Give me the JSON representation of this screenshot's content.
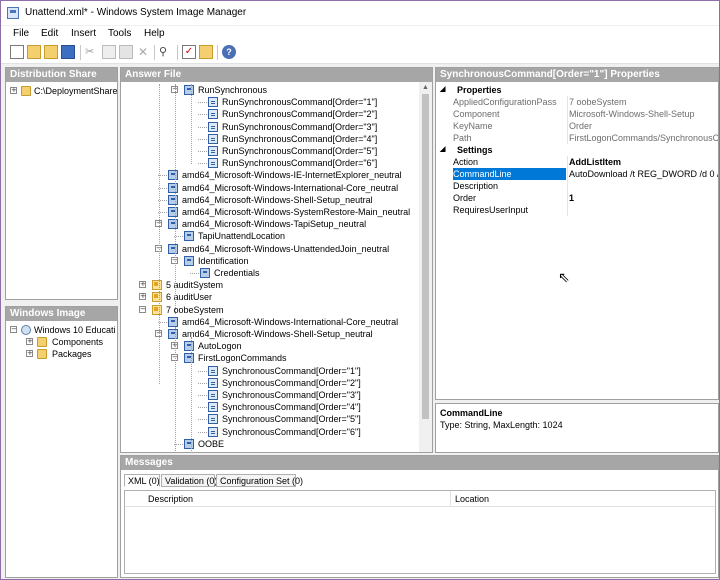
{
  "window": {
    "title": "Unattend.xml* - Windows System Image Manager"
  },
  "menu": [
    "File",
    "Edit",
    "Insert",
    "Tools",
    "Help"
  ],
  "toolbar": {
    "icons": [
      "new-icon",
      "open-icon",
      "open-folder-icon",
      "save-icon",
      "cut-icon",
      "copy-icon",
      "paste-icon",
      "delete-icon",
      "find-icon",
      "validate-icon",
      "create-configuration-set-icon",
      "help-icon"
    ]
  },
  "distribution_share": {
    "header": "Distribution Share",
    "root": "C:\\DeploymentShare"
  },
  "windows_image": {
    "header": "Windows Image",
    "root": "Windows 10 Educatio",
    "children": [
      "Components",
      "Packages"
    ]
  },
  "answer_file": {
    "header": "Answer File",
    "nodes": [
      {
        "text": "RunSynchronous",
        "icon": "folder"
      },
      {
        "text": "RunSynchronousCommand[Order=\"1\"]",
        "icon": "item"
      },
      {
        "text": "RunSynchronousCommand[Order=\"2\"]",
        "icon": "item"
      },
      {
        "text": "RunSynchronousCommand[Order=\"3\"]",
        "icon": "item"
      },
      {
        "text": "RunSynchronousCommand[Order=\"4\"]",
        "icon": "item"
      },
      {
        "text": "RunSynchronousCommand[Order=\"5\"]",
        "icon": "item"
      },
      {
        "text": "RunSynchronousCommand[Order=\"6\"]",
        "icon": "item"
      },
      {
        "text": "amd64_Microsoft-Windows-IE-InternetExplorer_neutral",
        "icon": "comp"
      },
      {
        "text": "amd64_Microsoft-Windows-International-Core_neutral",
        "icon": "comp"
      },
      {
        "text": "amd64_Microsoft-Windows-Shell-Setup_neutral",
        "icon": "comp"
      },
      {
        "text": "amd64_Microsoft-Windows-SystemRestore-Main_neutral",
        "icon": "comp"
      },
      {
        "text": "amd64_Microsoft-Windows-TapiSetup_neutral",
        "icon": "comp"
      },
      {
        "text": "TapiUnattendLocation",
        "icon": "comp"
      },
      {
        "text": "amd64_Microsoft-Windows-UnattendedJoin_neutral",
        "icon": "comp"
      },
      {
        "text": "Identification",
        "icon": "comp"
      },
      {
        "text": "Credentials",
        "icon": "comp"
      },
      {
        "text": "5 auditSystem",
        "icon": "pass"
      },
      {
        "text": "6 auditUser",
        "icon": "pass"
      },
      {
        "text": "7 oobeSystem",
        "icon": "pass"
      },
      {
        "text": "amd64_Microsoft-Windows-International-Core_neutral",
        "icon": "comp"
      },
      {
        "text": "amd64_Microsoft-Windows-Shell-Setup_neutral",
        "icon": "comp"
      },
      {
        "text": "AutoLogon",
        "icon": "comp"
      },
      {
        "text": "FirstLogonCommands",
        "icon": "folder"
      },
      {
        "text": "SynchronousCommand[Order=\"1\"]",
        "icon": "item"
      },
      {
        "text": "SynchronousCommand[Order=\"2\"]",
        "icon": "item"
      },
      {
        "text": "SynchronousCommand[Order=\"3\"]",
        "icon": "item"
      },
      {
        "text": "SynchronousCommand[Order=\"4\"]",
        "icon": "item"
      },
      {
        "text": "SynchronousCommand[Order=\"5\"]",
        "icon": "item"
      },
      {
        "text": "SynchronousCommand[Order=\"6\"]",
        "icon": "item"
      },
      {
        "text": "OOBE",
        "icon": "comp"
      }
    ]
  },
  "properties": {
    "header": "SynchronousCommand[Order=\"1\"] Properties",
    "sections": [
      {
        "label": "Properties",
        "rows": [
          {
            "name": "AppliedConfigurationPass",
            "value": "7 oobeSystem"
          },
          {
            "name": "Component",
            "value": "Microsoft-Windows-Shell-Setup"
          },
          {
            "name": "KeyName",
            "value": "Order"
          },
          {
            "name": "Path",
            "value": "FirstLogonCommands/SynchronousComm"
          }
        ]
      },
      {
        "label": "Settings",
        "rows": [
          {
            "name": "Action",
            "value": "AddListItem"
          },
          {
            "name": "CommandLine",
            "value": "AutoDownload /t REG_DWORD /d 0 /f"
          },
          {
            "name": "Description",
            "value": ""
          },
          {
            "name": "Order",
            "value": "1"
          },
          {
            "name": "RequiresUserInput",
            "value": ""
          }
        ]
      }
    ]
  },
  "description_box": {
    "title": "CommandLine",
    "text": "Type: String, MaxLength: 1024"
  },
  "messages": {
    "header": "Messages",
    "tabs": [
      "XML (0)",
      "Validation (0)",
      "Configuration Set (0)"
    ],
    "columns": [
      "Description",
      "Location"
    ]
  },
  "colors": {
    "selection": "#0078d7",
    "pane_header": "#a6a6a6",
    "window_border": "#8e6ea8"
  }
}
